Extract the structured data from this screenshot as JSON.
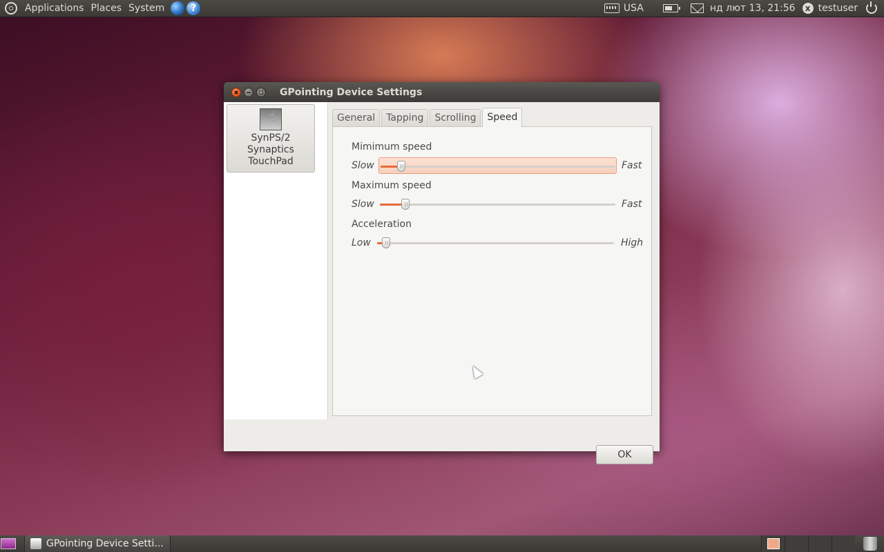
{
  "top_panel": {
    "menus": [
      "Applications",
      "Places",
      "System"
    ],
    "keyboard_layout": "USA",
    "clock": "нд лют 13, 21:56",
    "username": "testuser"
  },
  "window": {
    "title": "GPointing Device Settings",
    "device": {
      "name_line1": "SynPS/2",
      "name_line2": "Synaptics",
      "name_line3": "TouchPad"
    },
    "tabs": [
      "General",
      "Tapping",
      "Scrolling",
      "Speed"
    ],
    "active_tab": "Speed",
    "speed": {
      "min_speed": {
        "label": "Mimimum speed",
        "low": "Slow",
        "high": "Fast",
        "value": 0.06
      },
      "max_speed": {
        "label": "Maximum speed",
        "low": "Slow",
        "high": "Fast",
        "value": 0.08
      },
      "acceleration": {
        "label": "Acceleration",
        "low": "Low",
        "high": "High",
        "value": 0.01
      }
    },
    "ok_label": "OK"
  },
  "bottom_panel": {
    "task_label": "GPointing Device Setti..."
  },
  "colors": {
    "accent": "#e8693a",
    "panel": "#3c3b37"
  }
}
